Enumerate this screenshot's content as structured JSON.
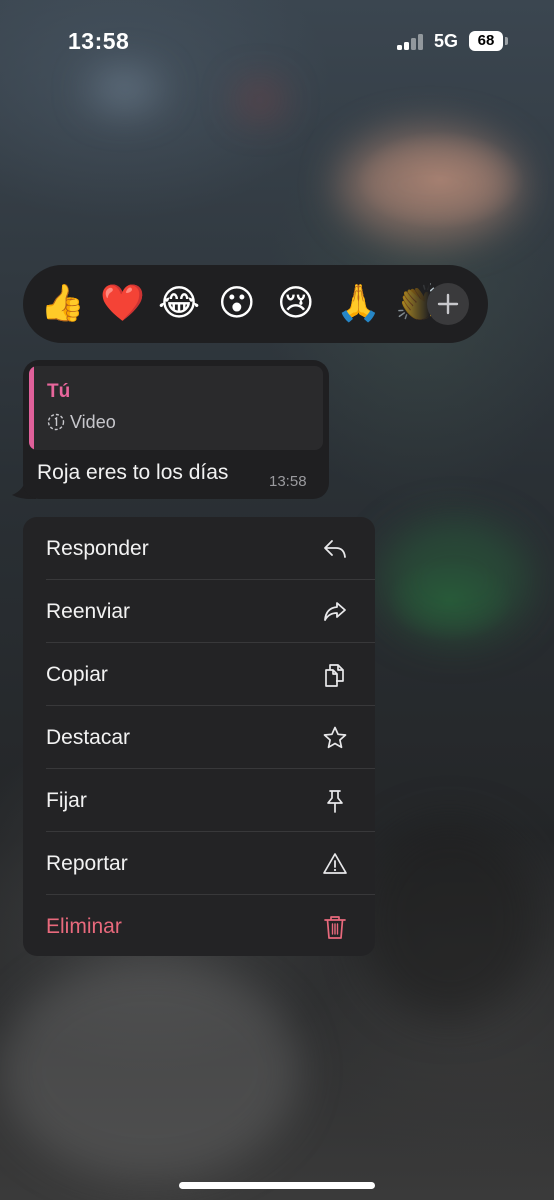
{
  "status_bar": {
    "time": "13:58",
    "network": "5G",
    "battery": "68"
  },
  "reactions": {
    "emojis": [
      "👍",
      "❤️",
      "😂",
      "😮",
      "😢",
      "🙏",
      "👏"
    ],
    "add_label": "+"
  },
  "message": {
    "quote_author": "Tú",
    "quote_text": "Video",
    "text": "Roja eres to los días",
    "time": "13:58"
  },
  "menu": {
    "items": [
      {
        "label": "Responder",
        "icon": "reply-icon"
      },
      {
        "label": "Reenviar",
        "icon": "forward-icon"
      },
      {
        "label": "Copiar",
        "icon": "copy-icon"
      },
      {
        "label": "Destacar",
        "icon": "star-icon"
      },
      {
        "label": "Fijar",
        "icon": "pin-icon"
      },
      {
        "label": "Reportar",
        "icon": "warning-icon"
      },
      {
        "label": "Eliminar",
        "icon": "trash-icon"
      }
    ]
  },
  "colors": {
    "accent_pink": "#e8669c",
    "danger": "#e8697c",
    "menu_bg": "#232325"
  }
}
